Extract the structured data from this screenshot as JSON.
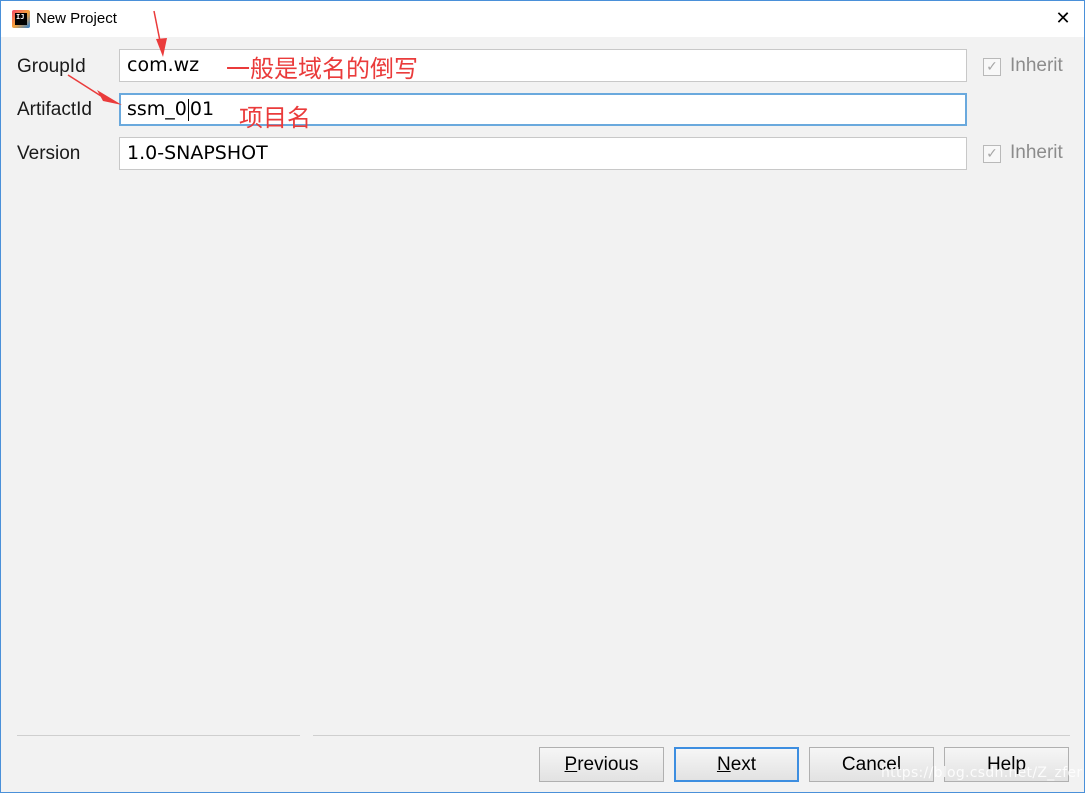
{
  "window": {
    "title": "New Project",
    "app_icon": "intellij-idea-icon",
    "close_glyph": "✕"
  },
  "form": {
    "groupid": {
      "label": "GroupId",
      "value": "com.wz",
      "inherit_label": "Inherit",
      "inherit_checked": true
    },
    "artifactid": {
      "label": "ArtifactId",
      "value_before_caret": "ssm_0",
      "value_after_caret": "01"
    },
    "version": {
      "label": "Version",
      "value": "1.0-SNAPSHOT",
      "inherit_label": "Inherit",
      "inherit_checked": true
    }
  },
  "annotations": {
    "groupid_note": "一般是域名的倒写",
    "artifactid_note": "项目名",
    "arrow_color": "#ea3b3b"
  },
  "buttons": {
    "previous": {
      "mnemonic": "P",
      "rest": "revious"
    },
    "next": {
      "mnemonic": "N",
      "rest": "ext"
    },
    "cancel": "Cancel",
    "help": "Help"
  },
  "watermark": "https://blog.csdn.net/Z_zfer",
  "colors": {
    "focus_border": "#6aa9dd",
    "default_button_border": "#3d8ee0",
    "annotation": "#ea3b3b"
  }
}
